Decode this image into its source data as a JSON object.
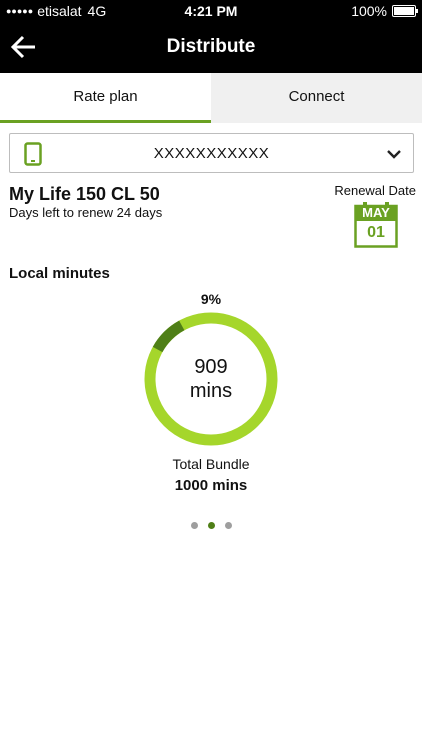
{
  "status_bar": {
    "signal": "●●●●●",
    "carrier": "etisalat",
    "network": "4G",
    "time": "4:21 PM",
    "battery": "100%"
  },
  "nav": {
    "title": "Distribute",
    "back_icon": "arrow-left-icon"
  },
  "tabs": [
    {
      "label": "Rate plan",
      "active": true
    },
    {
      "label": "Connect",
      "active": false
    }
  ],
  "selector": {
    "icon": "phone-icon",
    "number": "XXXXXXXXXXX",
    "dropdown_icon": "chevron-down-icon"
  },
  "plan": {
    "name": "My Life 150 CL 50",
    "days_left": "Days left to renew 24 days"
  },
  "renewal": {
    "label": "Renewal Date",
    "month": "MAY",
    "day": "01"
  },
  "usage": {
    "title": "Local minutes",
    "percent_label": "9%",
    "used_fraction": 0.09,
    "remaining_value": "909",
    "remaining_unit": "mins",
    "total_label": "Total Bundle",
    "total_value": "1000 mins"
  },
  "pager": {
    "count": 3,
    "active_index": 1
  },
  "colors": {
    "accent": "#6aa122",
    "ring_remaining": "#a5d62b",
    "ring_used": "#4f7f17"
  }
}
